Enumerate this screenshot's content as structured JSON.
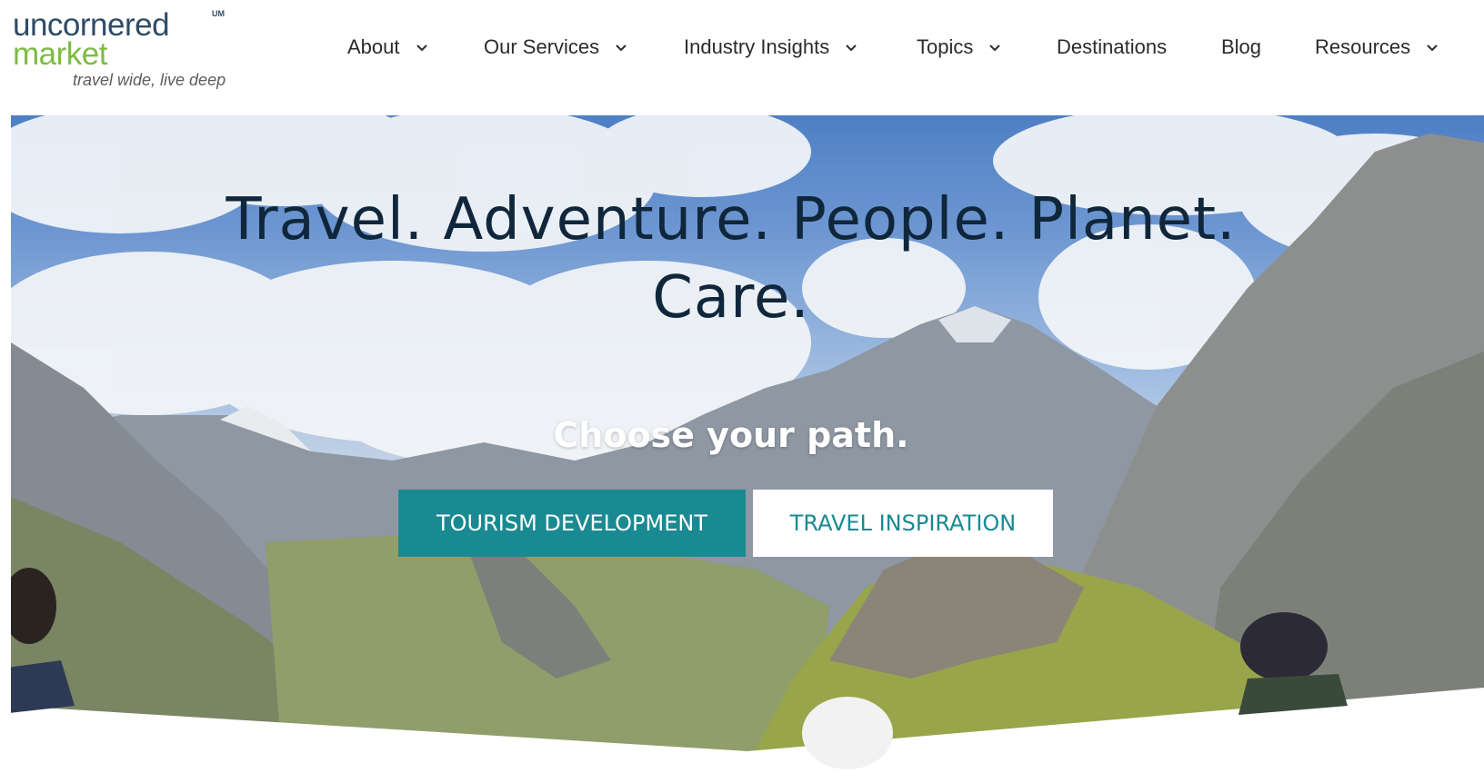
{
  "colors": {
    "brand_navy": "#2f4b66",
    "brand_green": "#7dbb43",
    "accent_teal": "#1a8a92",
    "headline_text": "#10263b"
  },
  "logo": {
    "line1": "uncornered",
    "line2": "market",
    "tm": "UM",
    "tagline": "travel wide, live deep"
  },
  "nav": {
    "items": [
      {
        "label": "About",
        "icon": "chevron-down-icon"
      },
      {
        "label": "Our Services",
        "icon": "chevron-down-icon"
      },
      {
        "label": "Industry Insights",
        "icon": "chevron-down-icon"
      },
      {
        "label": "Topics",
        "icon": "chevron-down-icon"
      },
      {
        "label": "Destinations"
      },
      {
        "label": "Blog"
      },
      {
        "label": "Resources",
        "icon": "chevron-down-icon"
      }
    ]
  },
  "hero": {
    "headline_line1": "Travel. Adventure. People. Planet.",
    "headline_line2": "Care.",
    "subhead": "Choose your path.",
    "primary_button": "TOURISM DEVELOPMENT",
    "secondary_button": "TRAVEL INSPIRATION"
  }
}
